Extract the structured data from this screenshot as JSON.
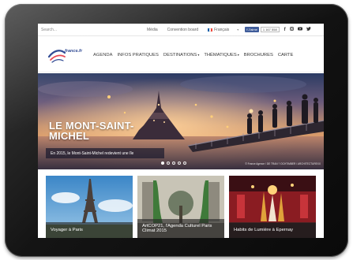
{
  "topbar": {
    "search_placeholder": "Search...",
    "links": [
      "Média",
      "Convention board"
    ],
    "language": "Français",
    "fb_like": "J'aime",
    "fb_count": "1 167 558",
    "social_icons": [
      "facebook-icon",
      "instagram-icon",
      "youtube-icon",
      "twitter-icon"
    ]
  },
  "navbar": {
    "logo_text": "france.fr",
    "items": [
      {
        "label": "AGENDA",
        "dropdown": false
      },
      {
        "label": "INFOS PRATIQUES",
        "dropdown": false
      },
      {
        "label": "DESTINATIONS",
        "dropdown": true
      },
      {
        "label": "THÉMATIQUES",
        "dropdown": true
      },
      {
        "label": "BROCHURES",
        "dropdown": false
      },
      {
        "label": "CARTE",
        "dropdown": false
      }
    ]
  },
  "hero": {
    "title": "LE MONT-SAINT-MICHEL",
    "caption": "En 2015, le Mont-Saint-Michel redevient une île",
    "credit": "© France Agence / DE TRAN ? OCHTIMBER / ARCHITECTUREXX",
    "slide_count": 5,
    "active_slide": 0
  },
  "cards": [
    {
      "label": "Voyager à Paris"
    },
    {
      "label": "ArtCOP21, l'Agenda Culturel Paris Climat 2015"
    },
    {
      "label": "Habits de Lumière à Epernay"
    }
  ],
  "colors": {
    "fb_blue": "#3b5998",
    "brand_blue": "#1e3a8a",
    "flag": [
      "#0055a4",
      "#ffffff",
      "#ef4135"
    ]
  }
}
